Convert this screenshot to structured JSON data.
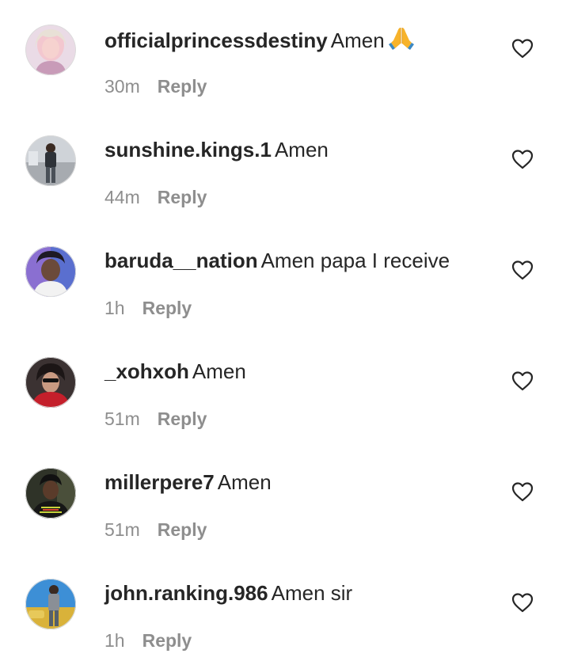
{
  "comments": [
    {
      "username": "officialprincessdestiny",
      "text": "Amen",
      "emoji": "folded-hands-icon",
      "time": "30m",
      "reply_label": "Reply",
      "avatar_colors": [
        "#f2c1c9",
        "#e9d5e2",
        "#b98fb0"
      ]
    },
    {
      "username": "sunshine.kings.1",
      "text": "Amen",
      "time": "44m",
      "reply_label": "Reply",
      "avatar_colors": [
        "#c9ccd1",
        "#2f343b",
        "#8e939a"
      ]
    },
    {
      "username": "baruda__nation",
      "text": "Amen papa I receive",
      "time": "1h",
      "reply_label": "Reply",
      "avatar_colors": [
        "#6c7fd6",
        "#2a1f3a",
        "#c7b6d9"
      ]
    },
    {
      "username": "_xohxoh",
      "text": "Amen",
      "time": "51m",
      "reply_label": "Reply",
      "avatar_colors": [
        "#3a2f2f",
        "#c41f2b",
        "#d9b7a3"
      ]
    },
    {
      "username": "millerpere7",
      "text": "Amen",
      "time": "51m",
      "reply_label": "Reply",
      "avatar_colors": [
        "#3a3d2e",
        "#1a1a1a",
        "#b8c24a"
      ]
    },
    {
      "username": "john.ranking.986",
      "text": "Amen sir",
      "time": "1h",
      "reply_label": "Reply",
      "avatar_colors": [
        "#d9b23a",
        "#3d8fd6",
        "#6d5a4a"
      ]
    }
  ],
  "icons": {
    "like": "heart-outline-icon"
  },
  "colors": {
    "text": "#262626",
    "meta": "#8e8e8e",
    "background": "#ffffff"
  }
}
